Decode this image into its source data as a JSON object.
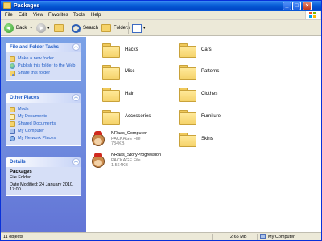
{
  "window": {
    "title": "Packages"
  },
  "menu": [
    "File",
    "Edit",
    "View",
    "Favorites",
    "Tools",
    "Help"
  ],
  "toolbar": {
    "back_label": "Back",
    "search_label": "Search",
    "folders_label": "Folders"
  },
  "tasks_panel": {
    "title": "File and Folder Tasks",
    "items": [
      "Make a new folder",
      "Publish this folder to the Web",
      "Share this folder"
    ]
  },
  "places_panel": {
    "title": "Other Places",
    "items": [
      "Mods",
      "My Documents",
      "Shared Documents",
      "My Computer",
      "My Network Places"
    ]
  },
  "details_panel": {
    "title": "Details",
    "name": "Packages",
    "type": "File Folder",
    "modified": "Date Modified: 24 January 2010, 17:00"
  },
  "folders": [
    "Hacks",
    "Cars",
    "Misc",
    "Patterns",
    "Hair",
    "Clothes",
    "Accessories",
    "Furniture",
    "Skins"
  ],
  "packages": [
    {
      "name": "NRaas_Computer",
      "type": "PACKAGE File",
      "size": "734KB"
    },
    {
      "name": "NRaas_StoryProgression",
      "type": "PACKAGE File",
      "size": "1,564KB"
    }
  ],
  "status": {
    "objects": "11 objects",
    "size": "2.65 MB",
    "location": "My Computer"
  },
  "colors": {
    "titlebar": "#0048c8",
    "task_pane": "#7ba2e7",
    "link": "#215dc6"
  }
}
